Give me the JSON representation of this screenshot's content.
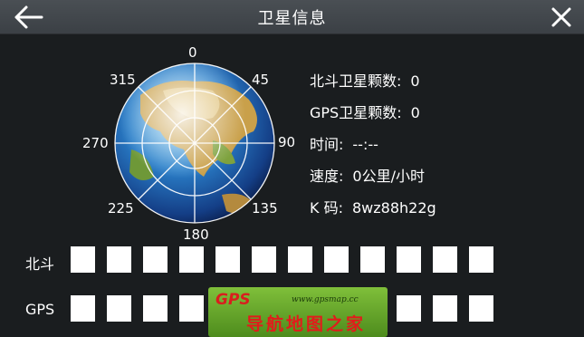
{
  "header": {
    "title": "卫星信息"
  },
  "compass": {
    "labels": [
      "0",
      "45",
      "90",
      "135",
      "180",
      "225",
      "270",
      "315"
    ]
  },
  "info": {
    "beidou_count_label": "北斗卫星颗数:",
    "beidou_count_value": "0",
    "gps_count_label": "GPS卫星颗数:",
    "gps_count_value": "0",
    "time_label": "时间:",
    "time_value": "--:--",
    "speed_label": "速度:",
    "speed_value": "0公里/小时",
    "k_code_label": "K 码:",
    "k_code_value": "8wz88h22g"
  },
  "signal_rows": {
    "beidou_label": "北斗",
    "gps_label": "GPS"
  },
  "watermark": {
    "brand": "GPS",
    "url": "www.gpsmap.cc",
    "name": "导航地图之家"
  },
  "colors": {
    "titlebar": "#3f4449",
    "background": "#1a1d1f",
    "watermark_green": "#6aa82c",
    "watermark_red": "#e21b1b"
  },
  "icons": {
    "back": "arrow-left-icon",
    "close": "close-icon",
    "globe": "globe-icon"
  }
}
